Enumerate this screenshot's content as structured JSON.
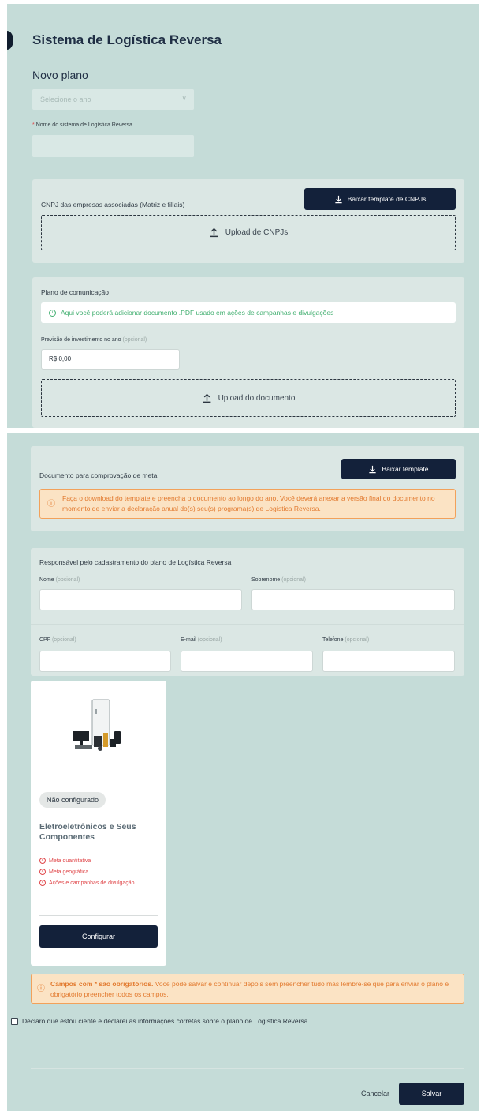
{
  "header": {
    "title": "Sistema de Logística Reversa",
    "subtitle": "Novo plano"
  },
  "form": {
    "year_placeholder": "Selecione o ano",
    "system_name_label": "Nome do sistema de Logística Reversa",
    "system_name_required_mark": "*"
  },
  "cnpj_section": {
    "label": "CNPJ das empresas associadas (Matriz e filiais)",
    "download_button": "Baixar template de CNPJs",
    "upload_label": "Upload de CNPJs"
  },
  "communication_section": {
    "label": "Plano de comunicação",
    "info_text": "Aqui você poderá adicionar documento .PDF usado em ações de campanhas e divulgações",
    "investment_label": "Previsão de investimento no ano",
    "investment_optional": "(opcional)",
    "investment_value": "R$ 0,00",
    "upload_label": "Upload do documento"
  },
  "goal_document_section": {
    "label": "Documento para comprovação de meta",
    "download_button": "Baixar template",
    "warning_text": "Faça o download do template e preencha o documento ao longo do ano. Você deverá anexar a versão final do documento no momento de enviar a declaração anual do(s) seu(s) programa(s) de Logística Reversa."
  },
  "responsible_section": {
    "label": "Responsável pelo cadastramento do plano de Logística Reversa",
    "fields": {
      "first_name": "Nome",
      "last_name": "Sobrenome",
      "cpf": "CPF",
      "email": "E-mail",
      "phone": "Telefone",
      "optional": "(opcional)"
    }
  },
  "category_card": {
    "status_badge": "Não configurado",
    "title": "Eletroeletrônicos e Seus Componentes",
    "requirements": [
      "Meta quantitativa",
      "Meta geográfica",
      "Ações e campanhas de divulgação"
    ],
    "configure_button": "Configurar"
  },
  "required_warning": {
    "bold": "Campos com * são obrigatórios.",
    "text": " Você pode salvar e continuar depois sem preencher tudo mas lembre-se que para enviar o plano é obrigatório preencher todos os campos."
  },
  "declaration": {
    "text": "Declaro que estou ciente e declarei as informações corretas sobre o plano de Logística Reversa."
  },
  "footer": {
    "cancel": "Cancelar",
    "save": "Salvar"
  },
  "colors": {
    "background": "#c5dcd8",
    "panel": "#dbe7e4",
    "primary_dark": "#13213a",
    "info_green": "#3fae6e",
    "warning_orange": "#e27a2f",
    "warning_bg": "#fbe3c4",
    "required_red": "#e0474a"
  },
  "icons": {
    "download": "download-icon",
    "upload": "upload-icon",
    "info": "info-circle-icon",
    "error": "x-circle-icon",
    "chevron": "chevron-down-icon"
  }
}
